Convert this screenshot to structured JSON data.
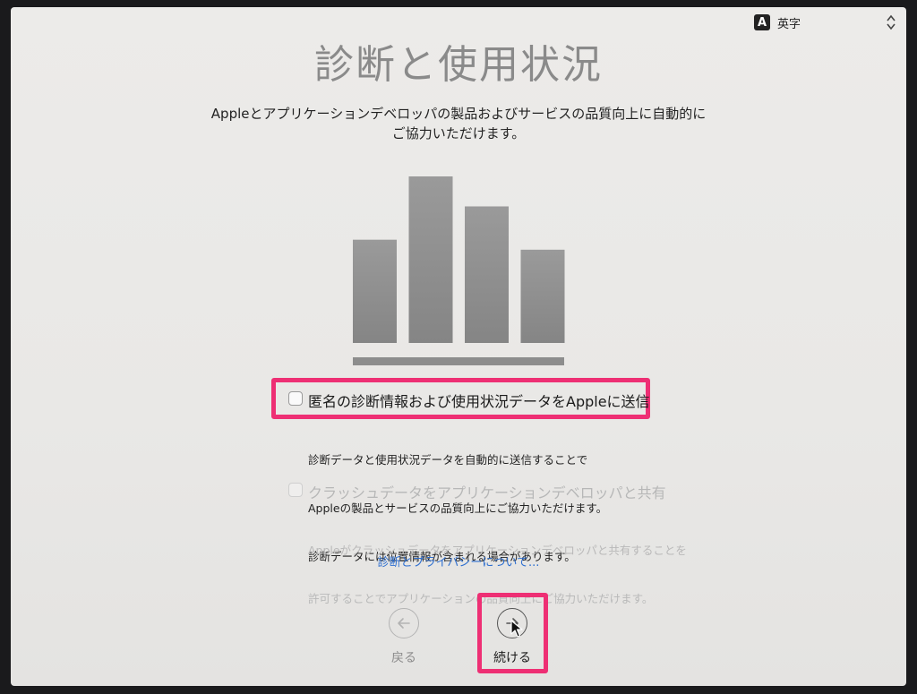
{
  "input_method": {
    "label": "英字",
    "badge": "A"
  },
  "title": "診断と使用状況",
  "intro": {
    "line1": "Appleとアプリケーションデベロッパの製品およびサービスの品質向上に自動的に",
    "line2": "ご協力いただけます。"
  },
  "illustration": {
    "icon": "bar-chart-icon",
    "relative_bar_heights": [
      0.62,
      1.0,
      0.82,
      0.56
    ]
  },
  "options": {
    "diagnostics": {
      "label": "匿名の診断情報および使用状況データをAppleに送信",
      "checked": false,
      "desc1": "診断データと使用状況データを自動的に送信することで",
      "desc2": "Appleの製品とサービスの品質向上にご協力いただけます。",
      "desc3": "診断データには位置情報が含まれる場合があります。"
    },
    "crash": {
      "label": "クラッシュデータをアプリケーションデベロッパと共有",
      "checked": false,
      "enabled": false,
      "desc1": "Appleがクラッシュデータをアプリケーションデベロッパと共有することを",
      "desc2": "許可することでアプリケーションの品質向上にご協力いただけます。"
    }
  },
  "privacy_link": "診断とプライバシーについて...",
  "nav": {
    "back": {
      "label": "戻る",
      "icon": "arrow-left-icon",
      "enabled": false
    },
    "continue": {
      "label": "続ける",
      "icon": "arrow-right-icon",
      "enabled": true
    }
  },
  "colors": {
    "highlight": "#ee2f74",
    "link": "#2e6fd0",
    "title": "#8a8a8a",
    "bar": "#8f8f8f"
  }
}
